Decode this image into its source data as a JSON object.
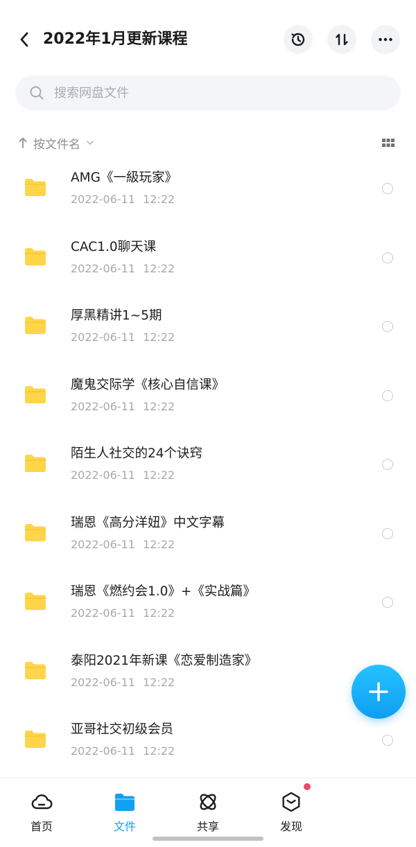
{
  "header": {
    "title": "2022年1月更新课程",
    "back_icon": "chevron-left-icon",
    "actions": [
      "history-icon",
      "transfer-icon",
      "more-icon"
    ]
  },
  "search": {
    "placeholder": "搜索网盘文件",
    "value": ""
  },
  "sort": {
    "label": "按文件名",
    "direction_icon": "arrow-up-icon"
  },
  "files": [
    {
      "name": "AMG《一級玩家》",
      "date": "2022-06-11 12:22"
    },
    {
      "name": "CAC1.0聊天课",
      "date": "2022-06-11 12:22"
    },
    {
      "name": "厚黑精讲1~5期",
      "date": "2022-06-11 12:22"
    },
    {
      "name": "魔鬼交际学《核心自信课》",
      "date": "2022-06-11 12:22"
    },
    {
      "name": "陌生人社交的24个诀窍",
      "date": "2022-06-11 12:22"
    },
    {
      "name": "瑞恩《高分洋妞》中文字幕",
      "date": "2022-06-11 12:22"
    },
    {
      "name": "瑞恩《燃约会1.0》+《实战篇》",
      "date": "2022-06-11 12:22"
    },
    {
      "name": "泰阳2021年新课《恋爱制造家》",
      "date": "2022-06-11 12:22"
    },
    {
      "name": "亚哥社交初级会员",
      "date": "2022-06-11 12:22"
    }
  ],
  "nav": [
    {
      "label": "首页",
      "icon": "cloud-home-icon",
      "active": false
    },
    {
      "label": "文件",
      "icon": "folder-icon",
      "active": true
    },
    {
      "label": "共享",
      "icon": "atom-share-icon",
      "active": false
    },
    {
      "label": "发现",
      "icon": "discover-icon",
      "active": false
    }
  ],
  "colors": {
    "accent": "#14a0f0",
    "folder": "#ffd54a",
    "badge": "#f2456b"
  }
}
